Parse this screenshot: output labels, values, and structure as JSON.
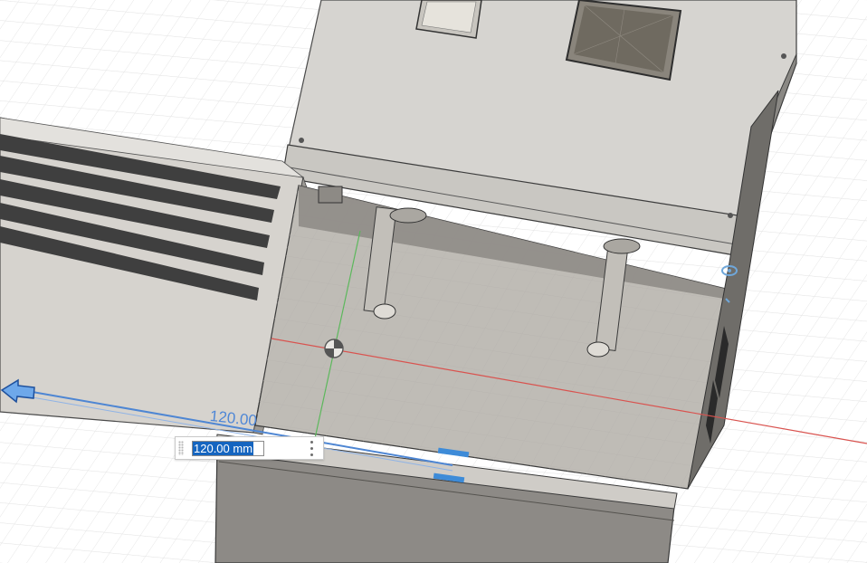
{
  "viewport": {
    "colors": {
      "background": "#ffffff",
      "grid": "#dadada",
      "model_body": "#d4d2ce",
      "model_dark": "#8f8d88",
      "model_edge": "#3a3a3a",
      "x_axis": "#d9534f",
      "y_axis": "#5cb85c",
      "manipulator": "#3d8bd8"
    },
    "icons": {
      "drag_arrow": "arrow-left-icon",
      "origin": "origin-marker-icon",
      "pivot": "pivot-ring-icon"
    }
  },
  "dimension": {
    "label": "120.00",
    "input_value": "120.00 mm",
    "menu_icon": "more-vertical-icon"
  }
}
